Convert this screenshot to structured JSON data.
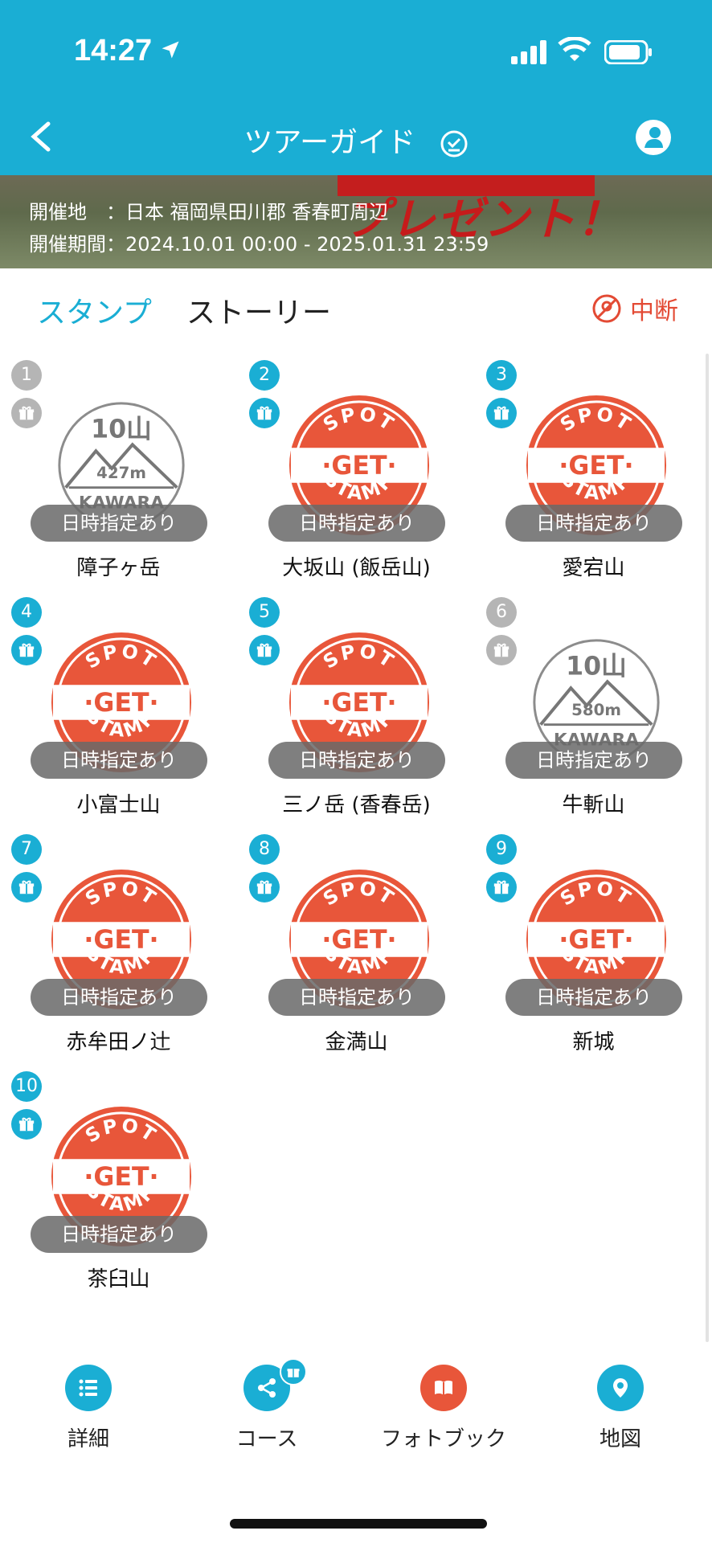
{
  "status": {
    "time": "14:27"
  },
  "header": {
    "title": "ツアーガイド"
  },
  "banner": {
    "present": "プレゼント！",
    "location_line": "開催地　：日本 福岡県田川郡 香春町周辺",
    "period_line": "開催期間：2024.10.01 00:00 - 2025.01.31 23:59"
  },
  "tabs": {
    "stamp": "スタンプ",
    "story": "ストーリー",
    "interrupt": "中断"
  },
  "spots": [
    {
      "num": "1",
      "name": "障子ヶ岳",
      "pill": "日時指定あり",
      "state": "locked",
      "alt": "427m",
      "count": "10山",
      "brand": "KAWARA"
    },
    {
      "num": "2",
      "name": "大坂山 (飯岳山)",
      "pill": "日時指定あり",
      "state": "got"
    },
    {
      "num": "3",
      "name": "愛宕山",
      "pill": "日時指定あり",
      "state": "got"
    },
    {
      "num": "4",
      "name": "小富士山",
      "pill": "日時指定あり",
      "state": "got"
    },
    {
      "num": "5",
      "name": "三ノ岳 (香春岳)",
      "pill": "日時指定あり",
      "state": "got"
    },
    {
      "num": "6",
      "name": "牛斬山",
      "pill": "日時指定あり",
      "state": "locked",
      "alt": "580m",
      "count": "10山",
      "brand": "KAWARA"
    },
    {
      "num": "7",
      "name": "赤牟田ノ辻",
      "pill": "日時指定あり",
      "state": "got"
    },
    {
      "num": "8",
      "name": "金満山",
      "pill": "日時指定あり",
      "state": "got"
    },
    {
      "num": "9",
      "name": "新城",
      "pill": "日時指定あり",
      "state": "got"
    },
    {
      "num": "10",
      "name": "茶臼山",
      "pill": "日時指定あり",
      "state": "got"
    }
  ],
  "stamp_text": {
    "top": "SPOT",
    "middle": "·GET·",
    "bottom": "STAMP"
  },
  "bottom_nav": [
    {
      "label": "詳細",
      "icon": "list-icon",
      "color": "#1aaed4"
    },
    {
      "label": "コース",
      "icon": "share-icon",
      "color": "#1aaed4"
    },
    {
      "label": "フォトブック",
      "icon": "book-icon",
      "color": "#e8563a"
    },
    {
      "label": "地図",
      "icon": "map-pin-icon",
      "color": "#1aaed4"
    }
  ],
  "colors": {
    "accent": "#1aaed4",
    "stamp_red": "#e8563a",
    "interrupt": "#e34a34"
  }
}
